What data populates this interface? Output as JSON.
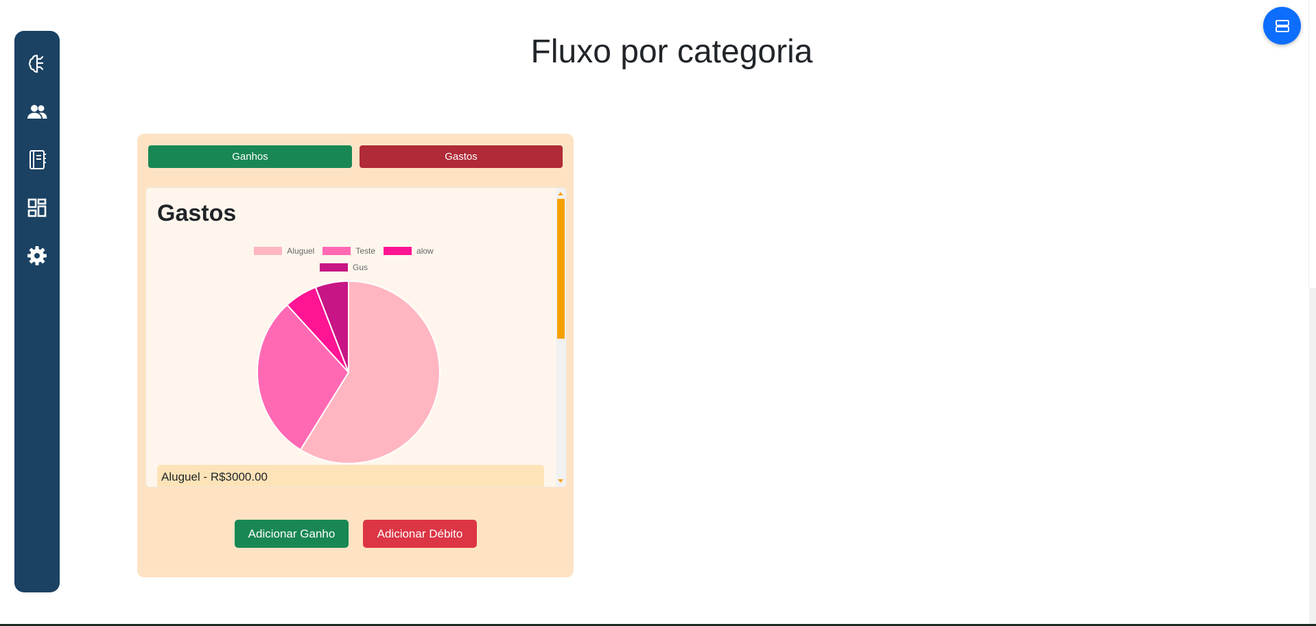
{
  "page": {
    "title": "Fluxo por categoria"
  },
  "sidebar": {
    "items": [
      {
        "icon": "brain-icon"
      },
      {
        "icon": "users-icon"
      },
      {
        "icon": "notebook-icon"
      },
      {
        "icon": "dashboard-icon"
      },
      {
        "icon": "gear-icon"
      }
    ]
  },
  "fab": {
    "icon": "stack-icon"
  },
  "tabs": {
    "ganhos_label": "Ganhos",
    "gastos_label": "Gastos"
  },
  "panel": {
    "title": "Gastos",
    "items": [
      {
        "label": "Aluguel - R$3000.00"
      }
    ]
  },
  "actions": {
    "add_income_label": "Adicionar Ganho",
    "add_debit_label": "Adicionar Débito"
  },
  "colors": {
    "sidebar": "#1b4263",
    "income": "#198754",
    "expense_tab": "#b02a37",
    "expense_button": "#dc3545",
    "card": "#fde3c4",
    "scroll_thumb": "#f7a100"
  },
  "chart_data": {
    "type": "pie",
    "labels": [
      "Aluguel",
      "Teste",
      "alow",
      "Gus"
    ],
    "values": [
      3000,
      1500,
      300,
      300
    ],
    "colors": [
      "#ffb6c1",
      "#ff69b4",
      "#ff1493",
      "#c71585"
    ],
    "legend": "top"
  }
}
